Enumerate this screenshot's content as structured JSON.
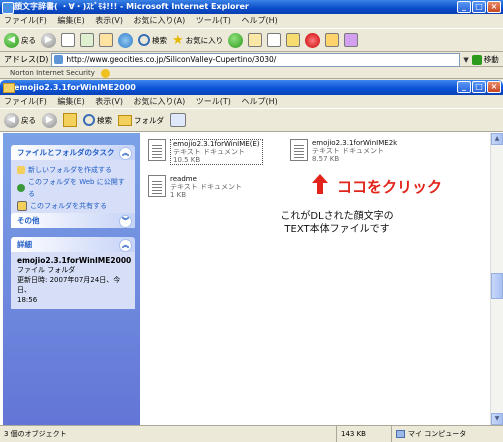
{
  "ie": {
    "title": "顔文字辞書( ・∀・)ｽﾋﾞﾓﾈ!!! - Microsoft Internet Explorer",
    "menu": [
      "ファイル(F)",
      "編集(E)",
      "表示(V)",
      "お気に入り(A)",
      "ツール(T)",
      "ヘルプ(H)"
    ],
    "toolbar": {
      "back": "戻る",
      "search": "検索",
      "favorites": "お気に入り"
    },
    "address": {
      "label": "アドレス(D)",
      "url": "http://www.geocities.co.jp/SiliconValley-Cupertino/3030/",
      "go": "移動"
    },
    "norton": "Norton Internet Security"
  },
  "explorer": {
    "title": "emojio2.3.1forWinIME2000",
    "menu": [
      "ファイル(F)",
      "編集(E)",
      "表示(V)",
      "お気に入り(A)",
      "ツール(T)",
      "ヘルプ(H)"
    ],
    "toolbar": {
      "back": "戻る",
      "search": "検索",
      "folders": "フォルダ"
    },
    "tasks": {
      "title": "ファイルとフォルダのタスク",
      "items": [
        "新しいフォルダを作成する",
        "このフォルダを Web に公開する",
        "このフォルダを共有する"
      ]
    },
    "other": {
      "title": "その他"
    },
    "details": {
      "title": "詳細",
      "name": "emojio2.3.1forWinIME2000",
      "type": "ファイル フォルダ",
      "updated": "更新日時: 2007年07月24日、今日、",
      "time": "18:56"
    },
    "files": [
      {
        "name": "emojio2.3.1forWinIME(E)",
        "type": "テキスト ドキュメント",
        "size": "10.5 KB"
      },
      {
        "name": "emojio2.3.1forWinIME2k",
        "type": "テキスト ドキュメント",
        "size": "8.57 KB"
      },
      {
        "name": "readme",
        "type": "テキスト ドキュメント",
        "size": "1 KB"
      }
    ],
    "annotation": {
      "click_here": "ココをクリック",
      "note_line1": "これがDLされた顔文字の",
      "note_line2": "TEXT本体ファイルです"
    },
    "status": {
      "objects": "3 個のオブジェクト",
      "size": "143 KB",
      "location": "マイ コンピュータ"
    }
  },
  "colors": {
    "annotation_red": "#e2231a",
    "xp_blue": "#0a4cc8"
  }
}
